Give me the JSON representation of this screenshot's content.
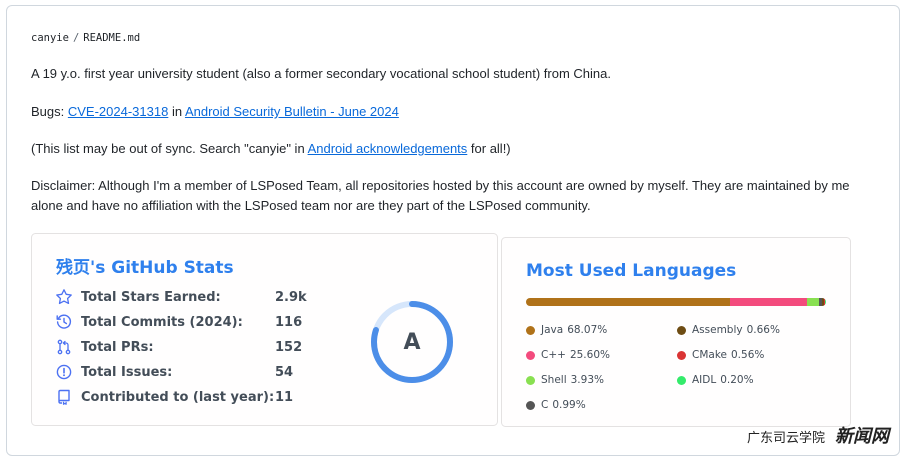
{
  "readme": {
    "path_user": "canyie",
    "path_sep": "/",
    "path_file": "README.md",
    "intro": "A 19 y.o. first year university student (also a former secondary vocational school student) from China.",
    "bugs_prefix": "Bugs: ",
    "bugs_cve": "CVE-2024-31318",
    "bugs_in": " in ",
    "bugs_bulletin": "Android Security Bulletin - June 2024",
    "sync_prefix": "(This list may be out of sync. Search \"canyie\" in ",
    "sync_link": "Android acknowledgements",
    "sync_suffix": " for all!)",
    "disclaimer": "Disclaimer: Although I'm a member of LSPosed Team, all repositories hosted by this account are owned by myself. They are maintained by me alone and have no affiliation with the LSPosed team nor are they part of the LSPosed community."
  },
  "stats_card": {
    "title": "残页's GitHub Stats",
    "rows": [
      {
        "icon": "star-icon",
        "label": "Total Stars Earned:",
        "value": "2.9k"
      },
      {
        "icon": "history-icon",
        "label": "Total Commits (2024):",
        "value": "116"
      },
      {
        "icon": "pull-request-icon",
        "label": "Total PRs:",
        "value": "152"
      },
      {
        "icon": "issue-icon",
        "label": "Total Issues:",
        "value": "54"
      },
      {
        "icon": "repo-icon",
        "label": "Contributed to (last year):",
        "value": "11"
      }
    ],
    "rank": "A",
    "rank_progress": 0.8,
    "accent": "#2f80ed"
  },
  "lang_card": {
    "title": "Most Used Languages",
    "languages": [
      {
        "name": "Java",
        "percent": "68.07%",
        "value": 68.07,
        "color": "#b07219"
      },
      {
        "name": "C++",
        "percent": "25.60%",
        "value": 25.6,
        "color": "#f34b7d"
      },
      {
        "name": "Shell",
        "percent": "3.93%",
        "value": 3.93,
        "color": "#89e051"
      },
      {
        "name": "C",
        "percent": "0.99%",
        "value": 0.99,
        "color": "#555555"
      },
      {
        "name": "Assembly",
        "percent": "0.66%",
        "value": 0.66,
        "color": "#6e4c13"
      },
      {
        "name": "CMake",
        "percent": "0.56%",
        "value": 0.56,
        "color": "#da3434"
      },
      {
        "name": "AIDL",
        "percent": "0.20%",
        "value": 0.2,
        "color": "#34eb6b"
      }
    ]
  },
  "watermark": {
    "text_a": "广东司云学院",
    "text_b": "新闻网"
  }
}
